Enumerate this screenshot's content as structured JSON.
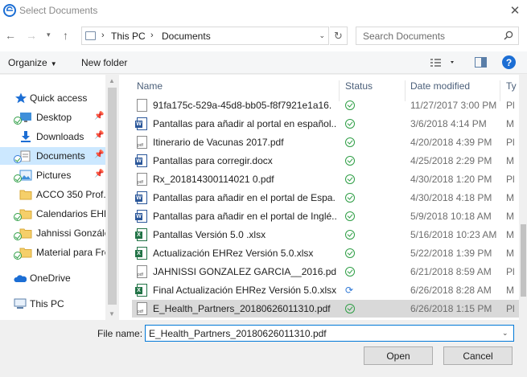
{
  "window": {
    "title": "Select Documents"
  },
  "address": {
    "crumbs": [
      "This PC",
      "Documents"
    ]
  },
  "search": {
    "placeholder": "Search Documents"
  },
  "toolbar": {
    "organize": "Organize",
    "new_folder": "New folder"
  },
  "nav": {
    "items": [
      {
        "label": "Quick access",
        "icon": "star-icon"
      },
      {
        "label": "Desktop",
        "icon": "desktop-icon",
        "pinned": true,
        "sync": true
      },
      {
        "label": "Downloads",
        "icon": "download-icon",
        "pinned": true
      },
      {
        "label": "Documents",
        "icon": "documents-icon",
        "pinned": true,
        "sync": true,
        "selected": true
      },
      {
        "label": "Pictures",
        "icon": "pictures-icon",
        "pinned": true,
        "sync": true
      },
      {
        "label": "ACCO 350 Prof.",
        "icon": "folder-icon"
      },
      {
        "label": "Calendarios EHP",
        "icon": "folder-icon",
        "sync": true
      },
      {
        "label": "Jahnissi Gonzále",
        "icon": "folder-icon",
        "sync": true
      },
      {
        "label": "Material para Fre",
        "icon": "folder-icon",
        "sync": true
      },
      {
        "label": "OneDrive",
        "icon": "onedrive-icon"
      },
      {
        "label": "This PC",
        "icon": "computer-icon"
      }
    ]
  },
  "columns": {
    "name": "Name",
    "status": "Status",
    "date": "Date modified",
    "type": "Ty"
  },
  "files": [
    {
      "name": "91fa175c-529a-45d8-bb05-f8f7921e1a16.",
      "icon": "doc",
      "status": "ok",
      "date": "11/27/2017 3:00 PM",
      "type": "Pl"
    },
    {
      "name": "Pantallas para añadir al portal en español...",
      "icon": "word",
      "status": "ok",
      "date": "3/6/2018 4:14 PM",
      "type": "M"
    },
    {
      "name": "Itinerario de Vacunas 2017.pdf",
      "icon": "pdf",
      "status": "ok",
      "date": "4/20/2018 4:39 PM",
      "type": "Pl"
    },
    {
      "name": "Pantallas para corregir.docx",
      "icon": "word",
      "status": "ok",
      "date": "4/25/2018 2:29 PM",
      "type": "M"
    },
    {
      "name": "Rx_201814300114021 0.pdf",
      "icon": "pdf",
      "status": "ok",
      "date": "4/30/2018 1:20 PM",
      "type": "Pl"
    },
    {
      "name": "Pantallas para añadir en el portal de Espa...",
      "icon": "word",
      "status": "ok",
      "date": "4/30/2018 4:18 PM",
      "type": "M"
    },
    {
      "name": "Pantallas para añadir en el portal de Inglé...",
      "icon": "word",
      "status": "ok",
      "date": "5/9/2018 10:18 AM",
      "type": "M"
    },
    {
      "name": "Pantallas Versión 5.0 .xlsx",
      "icon": "excel",
      "status": "ok",
      "date": "5/16/2018 10:23 AM",
      "type": "M"
    },
    {
      "name": "Actualización EHRez Versión 5.0.xlsx",
      "icon": "excel",
      "status": "ok",
      "date": "5/22/2018 1:39 PM",
      "type": "M"
    },
    {
      "name": "JAHNISSI GONZALEZ GARCIA__2016.pdf",
      "icon": "pdf",
      "status": "ok",
      "date": "6/21/2018 8:59 AM",
      "type": "Pl"
    },
    {
      "name": "Final Actualización EHRez Versión 5.0.xlsx",
      "icon": "excel",
      "status": "sync",
      "date": "6/26/2018 8:28 AM",
      "type": "M"
    },
    {
      "name": "E_Health_Partners_20180626011310.pdf",
      "icon": "pdf",
      "status": "ok",
      "date": "6/26/2018 1:15 PM",
      "type": "Pl",
      "selected": true
    }
  ],
  "footer": {
    "filename_label": "File name:",
    "filename_value": "E_Health_Partners_20180626011310.pdf",
    "open_label": "Open",
    "cancel_label": "Cancel"
  },
  "colors": {
    "accent": "#0078d7",
    "selected_nav": "#cce8ff",
    "selected_row": "#d9d9d9",
    "ok": "#2e9e45"
  }
}
